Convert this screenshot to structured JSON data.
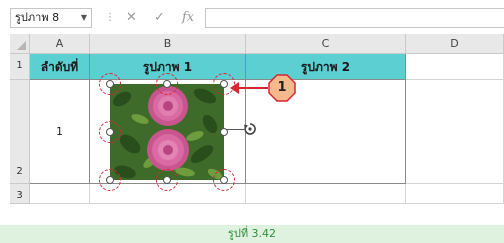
{
  "formula_bar": {
    "name_box_value": "รูปภาพ 8",
    "cancel_symbol": "✕",
    "enter_symbol": "✓",
    "function_symbol": "fx",
    "formula_value": ""
  },
  "columns": [
    "A",
    "B",
    "C",
    "D"
  ],
  "rows": [
    "1",
    "2",
    "3"
  ],
  "table": {
    "headers": [
      "ลำดับที่",
      "รูปภาพ 1",
      "รูปภาพ 2"
    ],
    "row_value": "1"
  },
  "callout_number": "1",
  "caption": "รูปที่ 3.42",
  "colors": {
    "header_fill": "#5bcfd2",
    "callout": "#d7262e",
    "caption_text": "#2f8f3a",
    "caption_bg": "#dff1df"
  },
  "icons": [
    "dropdown-arrow-icon",
    "cancel-icon",
    "enter-icon",
    "function-icon",
    "rotate-handle-icon",
    "flower-picture"
  ]
}
